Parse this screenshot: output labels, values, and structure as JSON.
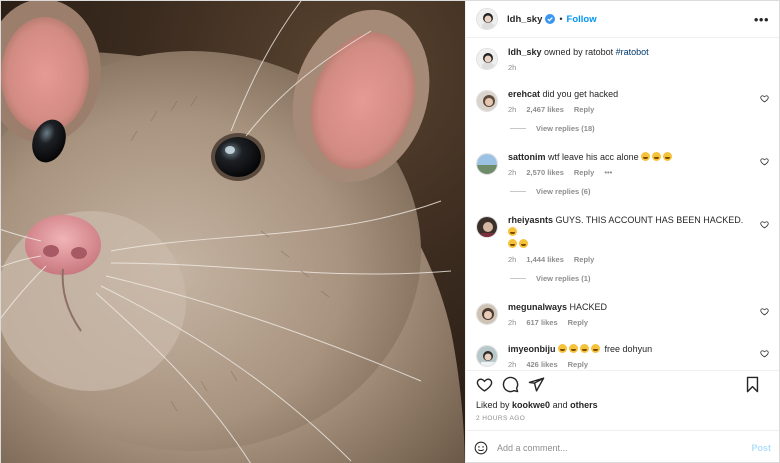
{
  "header": {
    "username": "ldh_sky",
    "separator": "•",
    "follow_label": "Follow",
    "more_icon": "more-horizontal-icon"
  },
  "caption": {
    "username": "ldh_sky",
    "text": "owned by ratobot",
    "hashtag": "#ratobot",
    "time": "2h"
  },
  "comments": [
    {
      "username": "erehcat",
      "text": "did you get hacked",
      "time": "2h",
      "likes": "2,467 likes",
      "reply_label": "Reply",
      "view_replies": "View replies (18)"
    },
    {
      "username": "sattonim",
      "text": "wtf leave his acc alone",
      "time": "2h",
      "likes": "2,570 likes",
      "reply_label": "Reply",
      "more_label": "•••",
      "view_replies": "View replies (6)"
    },
    {
      "username": "rheiyasnts",
      "text": "GUYS. THIS ACCOUNT HAS BEEN HACKED.",
      "time": "2h",
      "likes": "1,444 likes",
      "reply_label": "Reply",
      "view_replies": "View replies (1)"
    },
    {
      "username": "megunalways",
      "text": "HACKED",
      "time": "2h",
      "likes": "617 likes",
      "reply_label": "Reply"
    },
    {
      "username": "imyeonbiju",
      "text": "free dohyun",
      "time": "2h",
      "likes": "426 likes",
      "reply_label": "Reply"
    }
  ],
  "likes_line": {
    "prefix": "Liked by",
    "user": "kookwe0",
    "and": "and",
    "others": "others"
  },
  "timestamp": "2 HOURS AGO",
  "add_comment": {
    "placeholder": "Add a comment...",
    "post_label": "Post"
  },
  "colors": {
    "link_blue": "#0095f6",
    "verified_blue": "#3897f0",
    "muted_text": "#8e8e8e",
    "border": "#dbdbdb"
  }
}
